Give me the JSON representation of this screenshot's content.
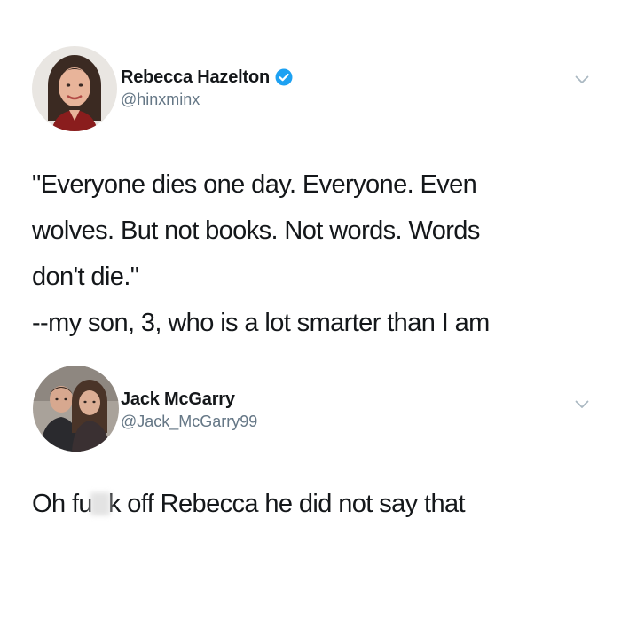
{
  "tweets": [
    {
      "display_name": "Rebecca Hazelton",
      "handle": "@hinxminx",
      "verified": true,
      "avatar_icon": "profile-photo-woman",
      "text_lines": [
        "\"Everyone dies one day. Everyone. Even",
        "wolves. But not books. Not words. Words",
        "don't die.\"",
        "--my son, 3, who is a lot smarter than I am"
      ]
    },
    {
      "display_name": "Jack McGarry",
      "handle": "@Jack_McGarry99",
      "verified": false,
      "avatar_icon": "profile-photo-couple",
      "text_before_censor": "Oh fu",
      "text_after_censor": "k off Rebecca he did not say that"
    }
  ],
  "colors": {
    "text": "#14171a",
    "secondary_text": "#657786",
    "verified_blue": "#1da1f2",
    "chevron": "#aab8c2",
    "background": "#ffffff"
  },
  "icons": {
    "verified": "verified-badge-icon",
    "chevron": "chevron-down-icon"
  }
}
